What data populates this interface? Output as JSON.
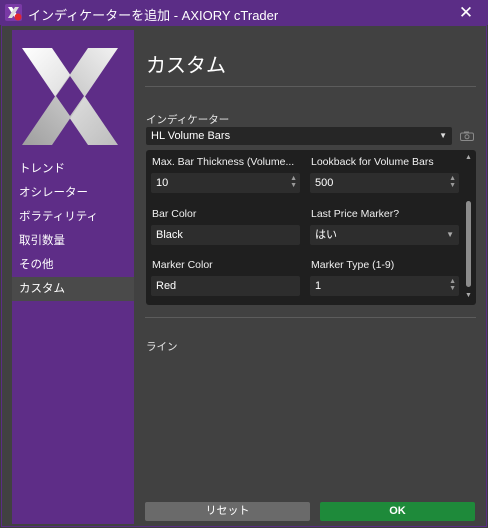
{
  "window": {
    "title": "インディケーターを追加 - AXIORY cTrader",
    "close_glyph": "✕"
  },
  "sidebar": {
    "items": [
      {
        "label": "トレンド",
        "active": false
      },
      {
        "label": "オシレーター",
        "active": false
      },
      {
        "label": "ボラティリティ",
        "active": false
      },
      {
        "label": "取引数量",
        "active": false
      },
      {
        "label": "その他",
        "active": false
      },
      {
        "label": "カスタム",
        "active": true
      }
    ]
  },
  "main": {
    "title": "カスタム",
    "indicator_label": "インディケーター",
    "indicator_value": "HL Volume Bars",
    "params": [
      {
        "label": "Max. Bar Thickness (Volume...",
        "value": "10",
        "control": "stepper"
      },
      {
        "label": "Lookback for Volume Bars",
        "value": "500",
        "control": "stepper"
      },
      {
        "label": "Bar Color",
        "value": "Black",
        "control": "text"
      },
      {
        "label": "Last Price Marker?",
        "value": "はい",
        "control": "select"
      },
      {
        "label": "Marker Color",
        "value": "Red",
        "control": "text"
      },
      {
        "label": "Marker Type (1-9)",
        "value": "1",
        "control": "stepper"
      }
    ],
    "section_line_label": "ライン"
  },
  "footer": {
    "reset_label": "リセット",
    "ok_label": "OK"
  },
  "colors": {
    "accent_purple": "#5e2d87",
    "ok_green": "#1e8a3a",
    "panel_bg": "#414141",
    "params_bg": "#1f1f1f"
  }
}
